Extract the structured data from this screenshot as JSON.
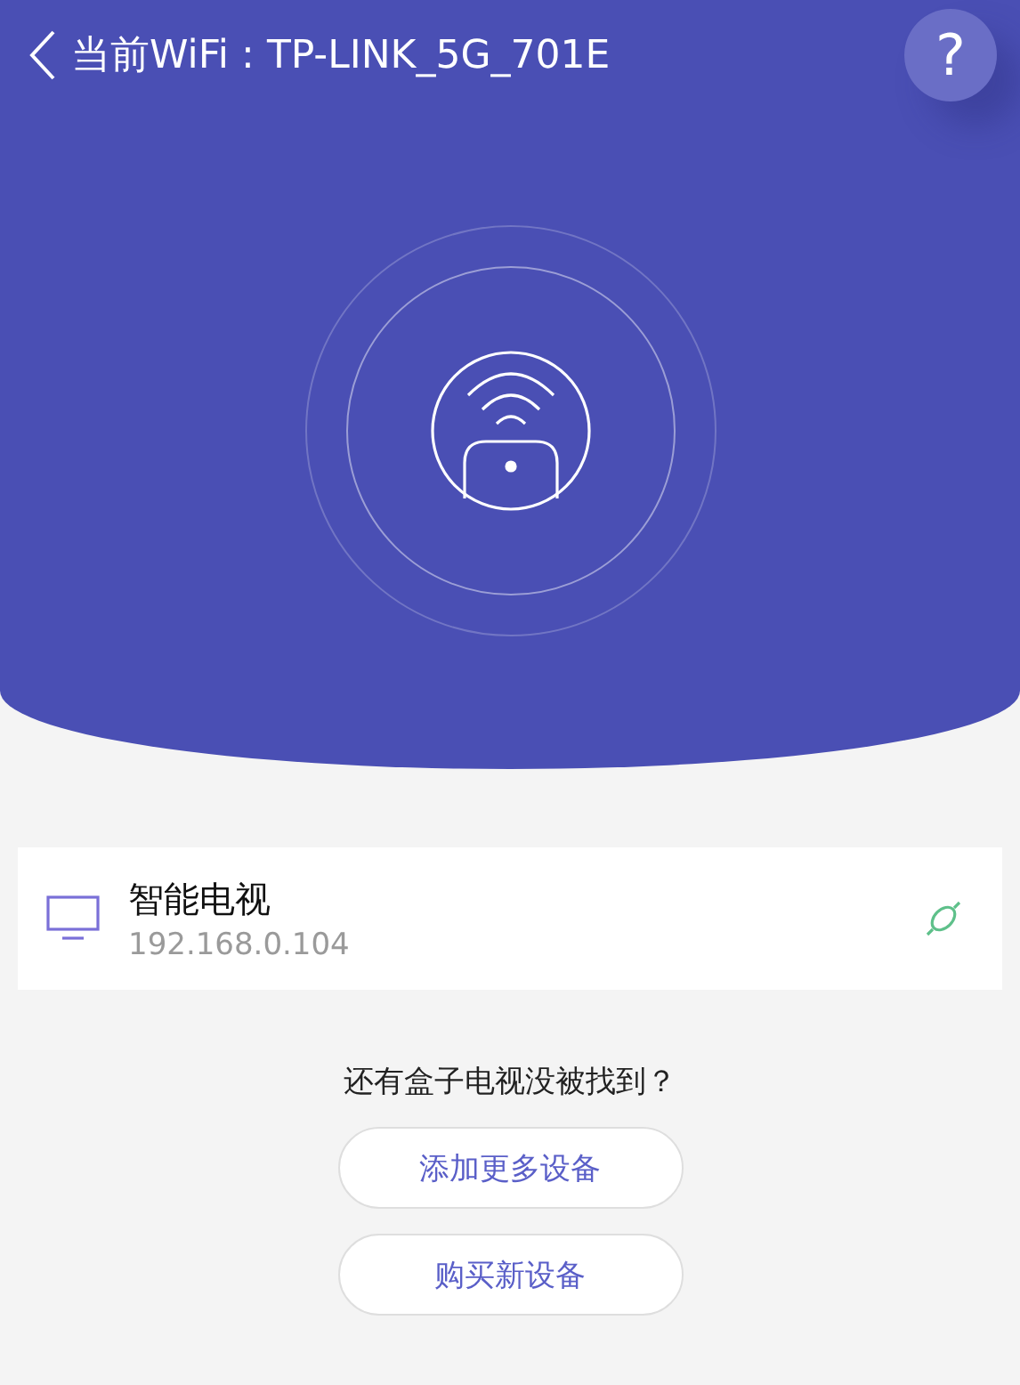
{
  "header": {
    "title": "当前WiFi : TP-LINK_5G_701E",
    "help": "?"
  },
  "devices": [
    {
      "name": "智能电视",
      "ip": "192.168.0.104"
    }
  ],
  "prompt": "还有盒子电视没被找到？",
  "buttons": [
    "添加更多设备",
    "购买新设备"
  ]
}
